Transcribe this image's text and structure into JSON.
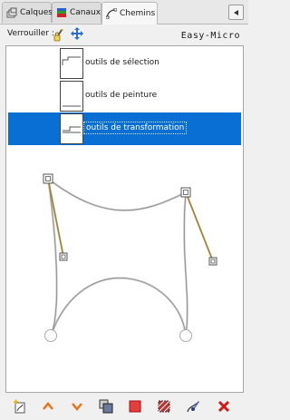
{
  "tabs": [
    {
      "label": "Calques",
      "icon": "layers-icon"
    },
    {
      "label": "Canaux",
      "icon": "channels-icon"
    },
    {
      "label": "Chemins",
      "icon": "paths-icon"
    }
  ],
  "active_tab": "Chemins",
  "lock": {
    "label": "Verrouiller :",
    "icons": [
      "lock-stroke-icon",
      "lock-position-icon"
    ]
  },
  "brand": "Easy-Micro",
  "paths": [
    {
      "label": "outils de sélection",
      "selected": false
    },
    {
      "label": "outils de peinture",
      "selected": false
    },
    {
      "label": "outils de transformation",
      "selected": true
    }
  ],
  "colors": {
    "selection": "#0a6fd4",
    "accent_orange": "#e8731a",
    "delete_red": "#d11a1a"
  },
  "toolbar": [
    {
      "name": "new-path-button",
      "icon": "new-path-icon"
    },
    {
      "name": "raise-path-button",
      "icon": "arrow-up-icon"
    },
    {
      "name": "lower-path-button",
      "icon": "arrow-down-icon"
    },
    {
      "name": "duplicate-path-button",
      "icon": "duplicate-icon"
    },
    {
      "name": "path-to-selection-button",
      "icon": "path-to-selection-icon"
    },
    {
      "name": "selection-to-path-button",
      "icon": "selection-to-path-icon"
    },
    {
      "name": "paint-along-path-button",
      "icon": "paint-path-icon"
    },
    {
      "name": "delete-path-button",
      "icon": "delete-icon"
    }
  ]
}
